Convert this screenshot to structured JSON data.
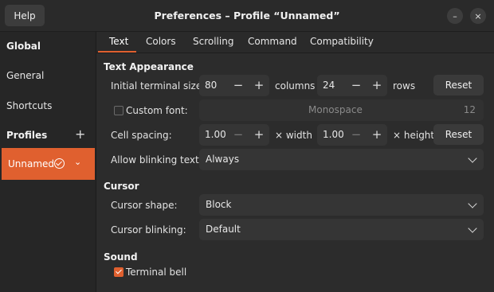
{
  "window": {
    "title": "Preferences – Profile “Unnamed”",
    "help_label": "Help",
    "minimize_icon": "–",
    "close_icon": "×"
  },
  "sidebar": {
    "global_heading": "Global",
    "items": [
      {
        "label": "General"
      },
      {
        "label": "Shortcuts"
      }
    ],
    "profiles_heading": "Profiles",
    "add_icon": "+",
    "profile": {
      "label": "Unnamed",
      "chevron": "⌄"
    }
  },
  "tabs": [
    {
      "label": "Text",
      "active": true
    },
    {
      "label": "Colors"
    },
    {
      "label": "Scrolling"
    },
    {
      "label": "Command"
    },
    {
      "label": "Compatibility"
    }
  ],
  "text_appearance": {
    "heading": "Text Appearance",
    "initial_size_label": "Initial terminal size:",
    "columns_value": "80",
    "columns_unit": "columns",
    "rows_value": "24",
    "rows_unit": "rows",
    "reset_label": "Reset",
    "custom_font_label": "Custom font:",
    "custom_font_checked": false,
    "font_name": "Monospace",
    "font_size": "12",
    "cell_spacing_label": "Cell spacing:",
    "width_value": "1.00",
    "width_unit": "× width",
    "height_value": "1.00",
    "height_unit": "× height",
    "blinking_text_label": "Allow blinking text:",
    "blinking_text_value": "Always"
  },
  "cursor": {
    "heading": "Cursor",
    "shape_label": "Cursor shape:",
    "shape_value": "Block",
    "blinking_label": "Cursor blinking:",
    "blinking_value": "Default"
  },
  "sound": {
    "heading": "Sound",
    "bell_label": "Terminal bell",
    "bell_checked": true
  },
  "spin": {
    "minus": "−",
    "plus": "+"
  },
  "colors": {
    "accent": "#e0602f",
    "background": "#2c2c2c",
    "field": "#353535"
  }
}
